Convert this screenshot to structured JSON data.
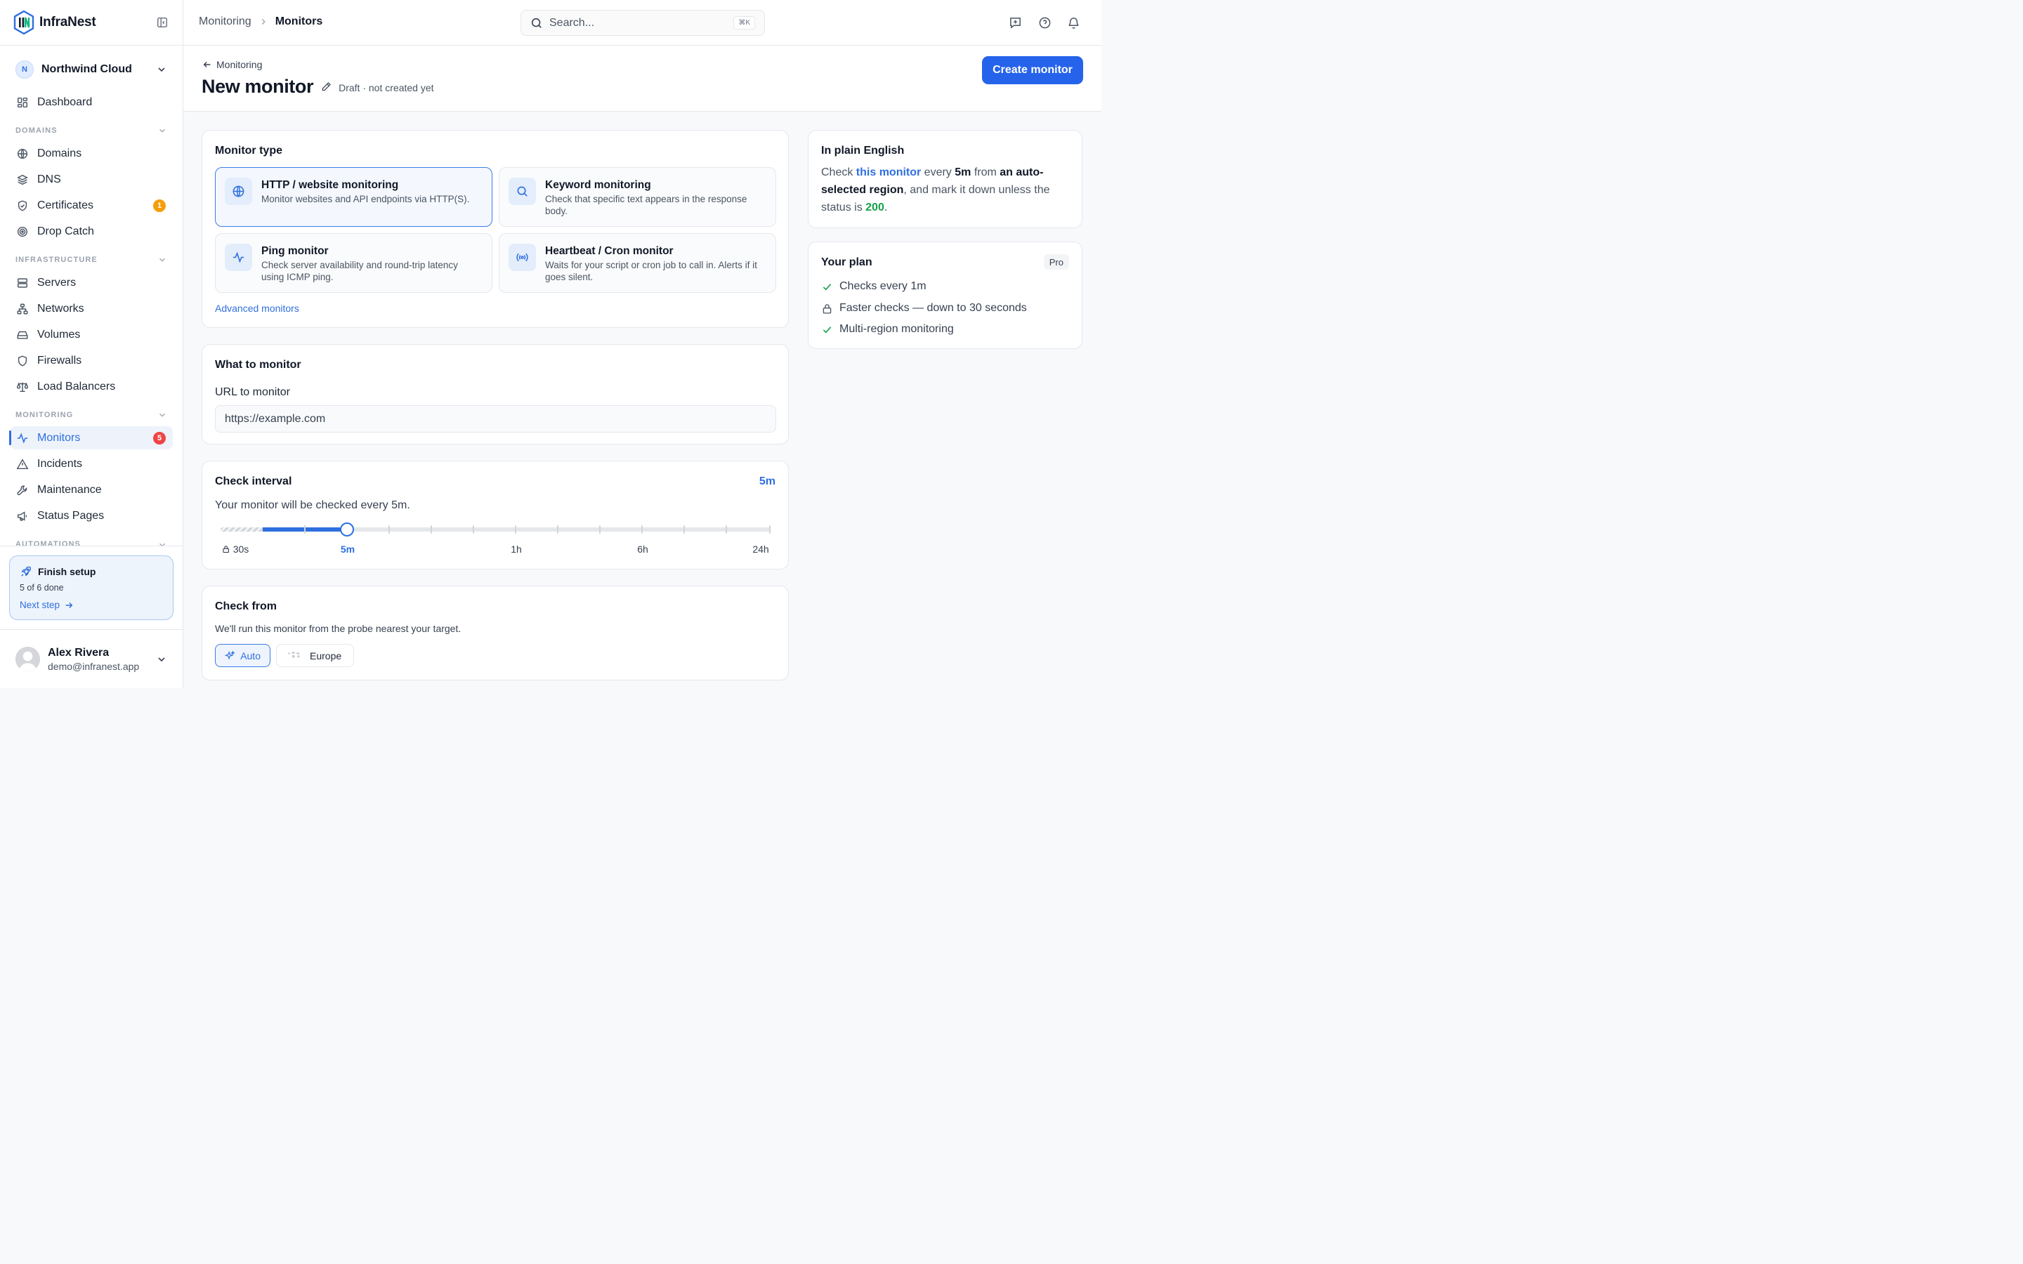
{
  "brand": {
    "name": "InfraNest"
  },
  "org": {
    "initial": "N",
    "name": "Northwind Cloud"
  },
  "sidebar": {
    "dashboard": "Dashboard",
    "sections": {
      "domains": "DOMAINS",
      "infrastructure": "INFRASTRUCTURE",
      "monitoring": "MONITORING",
      "automations": "AUTOMATIONS"
    },
    "items": {
      "domains": "Domains",
      "dns": "DNS",
      "certificates": "Certificates",
      "certificates_badge": "1",
      "drop_catch": "Drop Catch",
      "servers": "Servers",
      "networks": "Networks",
      "volumes": "Volumes",
      "firewalls": "Firewalls",
      "load_balancers": "Load Balancers",
      "monitors": "Monitors",
      "monitors_badge": "5",
      "incidents": "Incidents",
      "maintenance": "Maintenance",
      "status_pages": "Status Pages"
    },
    "active_item": "Monitors"
  },
  "setup": {
    "title": "Finish setup",
    "progress": "5 of 6 done",
    "link": "Next step"
  },
  "user": {
    "name": "Alex Rivera",
    "email": "demo@infranest.app"
  },
  "topbar": {
    "breadcrumb": [
      "Monitoring",
      "Monitors"
    ],
    "search_placeholder": "Search...",
    "search_shortcut": "⌘K"
  },
  "header": {
    "back_label": "Monitoring",
    "title": "New monitor",
    "status": "Draft · not created yet",
    "primary_action": "Create monitor"
  },
  "monitor_type": {
    "title": "Monitor type",
    "options": [
      {
        "icon": "globe-icon",
        "title": "HTTP / website monitoring",
        "desc": "Monitor websites and API endpoints via HTTP(S).",
        "selected": true
      },
      {
        "icon": "search-icon",
        "title": "Keyword monitoring",
        "desc": "Check that specific text appears in the response body.",
        "selected": false
      },
      {
        "icon": "activity-icon",
        "title": "Ping monitor",
        "desc": "Check server availability and round-trip latency using ICMP ping.",
        "selected": false
      },
      {
        "icon": "broadcast-icon",
        "title": "Heartbeat / Cron monitor",
        "desc": "Waits for your script or cron job to call in. Alerts if it goes silent.",
        "selected": false
      }
    ],
    "advanced_link": "Advanced monitors"
  },
  "what_to_monitor": {
    "title": "What to monitor",
    "url_label": "URL to monitor",
    "url_placeholder": "https://example.com"
  },
  "check_interval": {
    "title": "Check interval",
    "value": "5m",
    "description": "Your monitor will be checked every 5m.",
    "labels": [
      "30s",
      "5m",
      "1h",
      "6h",
      "24h"
    ],
    "selected_label": "5m"
  },
  "check_from": {
    "title": "Check from",
    "description": "We'll run this monitor from the probe nearest your target.",
    "options": [
      "Auto",
      "Europe"
    ],
    "selected": "Auto"
  },
  "plain_english": {
    "title": "In plain English",
    "p1": "Check ",
    "monitor": "this monitor",
    "p2": " every ",
    "interval": "5m",
    "p3": " from ",
    "region": "an auto-selected region",
    "p4": ", and mark it down unless the status is ",
    "status": "200",
    "p5": "."
  },
  "plan": {
    "title": "Your plan",
    "badge": "Pro",
    "features": [
      {
        "icon": "check-icon",
        "text": "Checks every 1m"
      },
      {
        "icon": "lock-icon",
        "text": "Faster checks — down to 30 seconds"
      },
      {
        "icon": "check-icon",
        "text": "Multi-region monitoring"
      }
    ]
  },
  "colors": {
    "accent": "#2f6fdf",
    "primary_button": "#2563eb",
    "badge_orange": "#f59e0b",
    "badge_red": "#ef4444",
    "success": "#16a34a"
  }
}
